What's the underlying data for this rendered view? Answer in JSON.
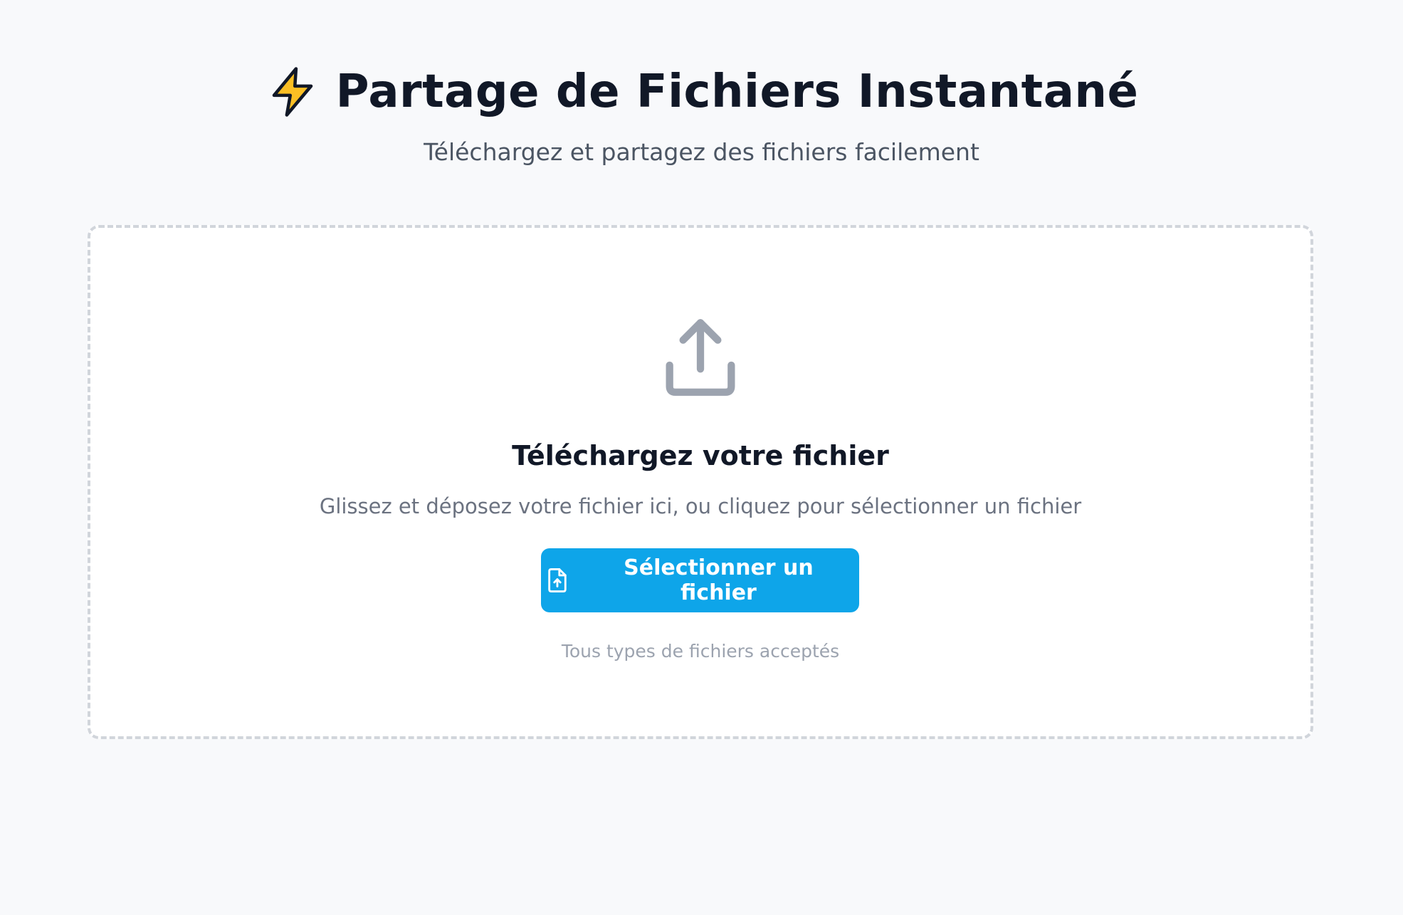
{
  "header": {
    "icon": "lightning-bolt-icon",
    "title": "Partage de Fichiers Instantané",
    "subtitle": "Téléchargez et partagez des fichiers facilement"
  },
  "dropzone": {
    "icon": "upload-icon",
    "title": "Téléchargez votre fichier",
    "description": "Glissez et déposez votre fichier ici, ou cliquez pour sélectionner un fichier",
    "button": {
      "icon": "file-upload-icon",
      "label": "Sélectionner un fichier"
    },
    "hint": "Tous types de fichiers acceptés"
  },
  "colors": {
    "background": "#f8f9fb",
    "accent": "#0ea5e9",
    "bolt": "#fbbf24",
    "icon_gray": "#9ca3af"
  }
}
